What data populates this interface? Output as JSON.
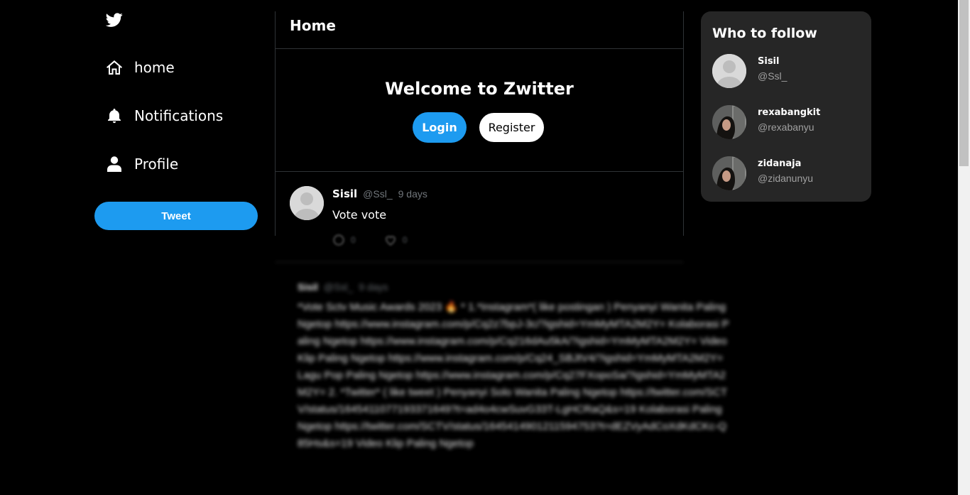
{
  "sidebar": {
    "logo_icon": "twitter-bird-icon",
    "nav": [
      {
        "label": "home",
        "icon": "home-icon"
      },
      {
        "label": "Notifications",
        "icon": "bell-icon"
      },
      {
        "label": "Profile",
        "icon": "user-icon"
      }
    ],
    "tweet_button": "Tweet"
  },
  "main": {
    "header_title": "Home",
    "welcome": {
      "title": "Welcome to Zwitter",
      "login_label": "Login",
      "register_label": "Register"
    },
    "tweets": [
      {
        "name": "Sisil",
        "handle": "@Ssl_",
        "time": "9 days",
        "body": "Vote vote",
        "reply_count": "0",
        "like_count": "0"
      },
      {
        "name": "Sisil",
        "handle": "@Ssl_",
        "time": "9 days",
        "body": "*Vote Sctv Music Awards 2023 🔥 * 1.*Instagram*( like postingan ) Penyanyi Wanita Paling Ngetop https://www.instagram.com/p/Cq2z7bpJ-3c/?igshid=YmMyMTA2M2Y= Kolaborasi Paling Ngetop https://www.instagram.com/p/Cq216dAu5kA/?igshid=YmMyMTA2M2Y= Video Klip Paling Ngetop https://www.instagram.com/p/Cq24_SBJtV4/?igshid=YmMyMTA2M2Y= Lagu Pop Paling Ngetop https://www.instagram.com/p/Cq27FXopoSa/?igshid=YmMyMTA2M2Y= 2. *Twitter* ( like tweet ) Penyanyi Solo Wanita Paling Ngetop https://twitter.com/SCTV/status/1645411077193371649?t=ad4o4cwSuvG33T-LgHCRaQ&s=19 Kolaborasi Paling Ngetop https://twitter.com/SCTV/status/1645414901211594753?t=dEZVyAdCoXdKdCKc-Q85Hs&s=19 Video Klip Paling Ngetop"
      }
    ]
  },
  "who_to_follow": {
    "title": "Who to follow",
    "users": [
      {
        "name": "Sisil",
        "handle": "@Ssl_",
        "avatar": "default-avatar"
      },
      {
        "name": "rexabangkit",
        "handle": "@rexabanyu",
        "avatar": "photo-avatar"
      },
      {
        "name": "zidanaja",
        "handle": "@zidanunyu",
        "avatar": "photo-avatar"
      }
    ]
  },
  "colors": {
    "accent": "#1d9bf0",
    "background": "#000000",
    "panel": "#262626"
  }
}
